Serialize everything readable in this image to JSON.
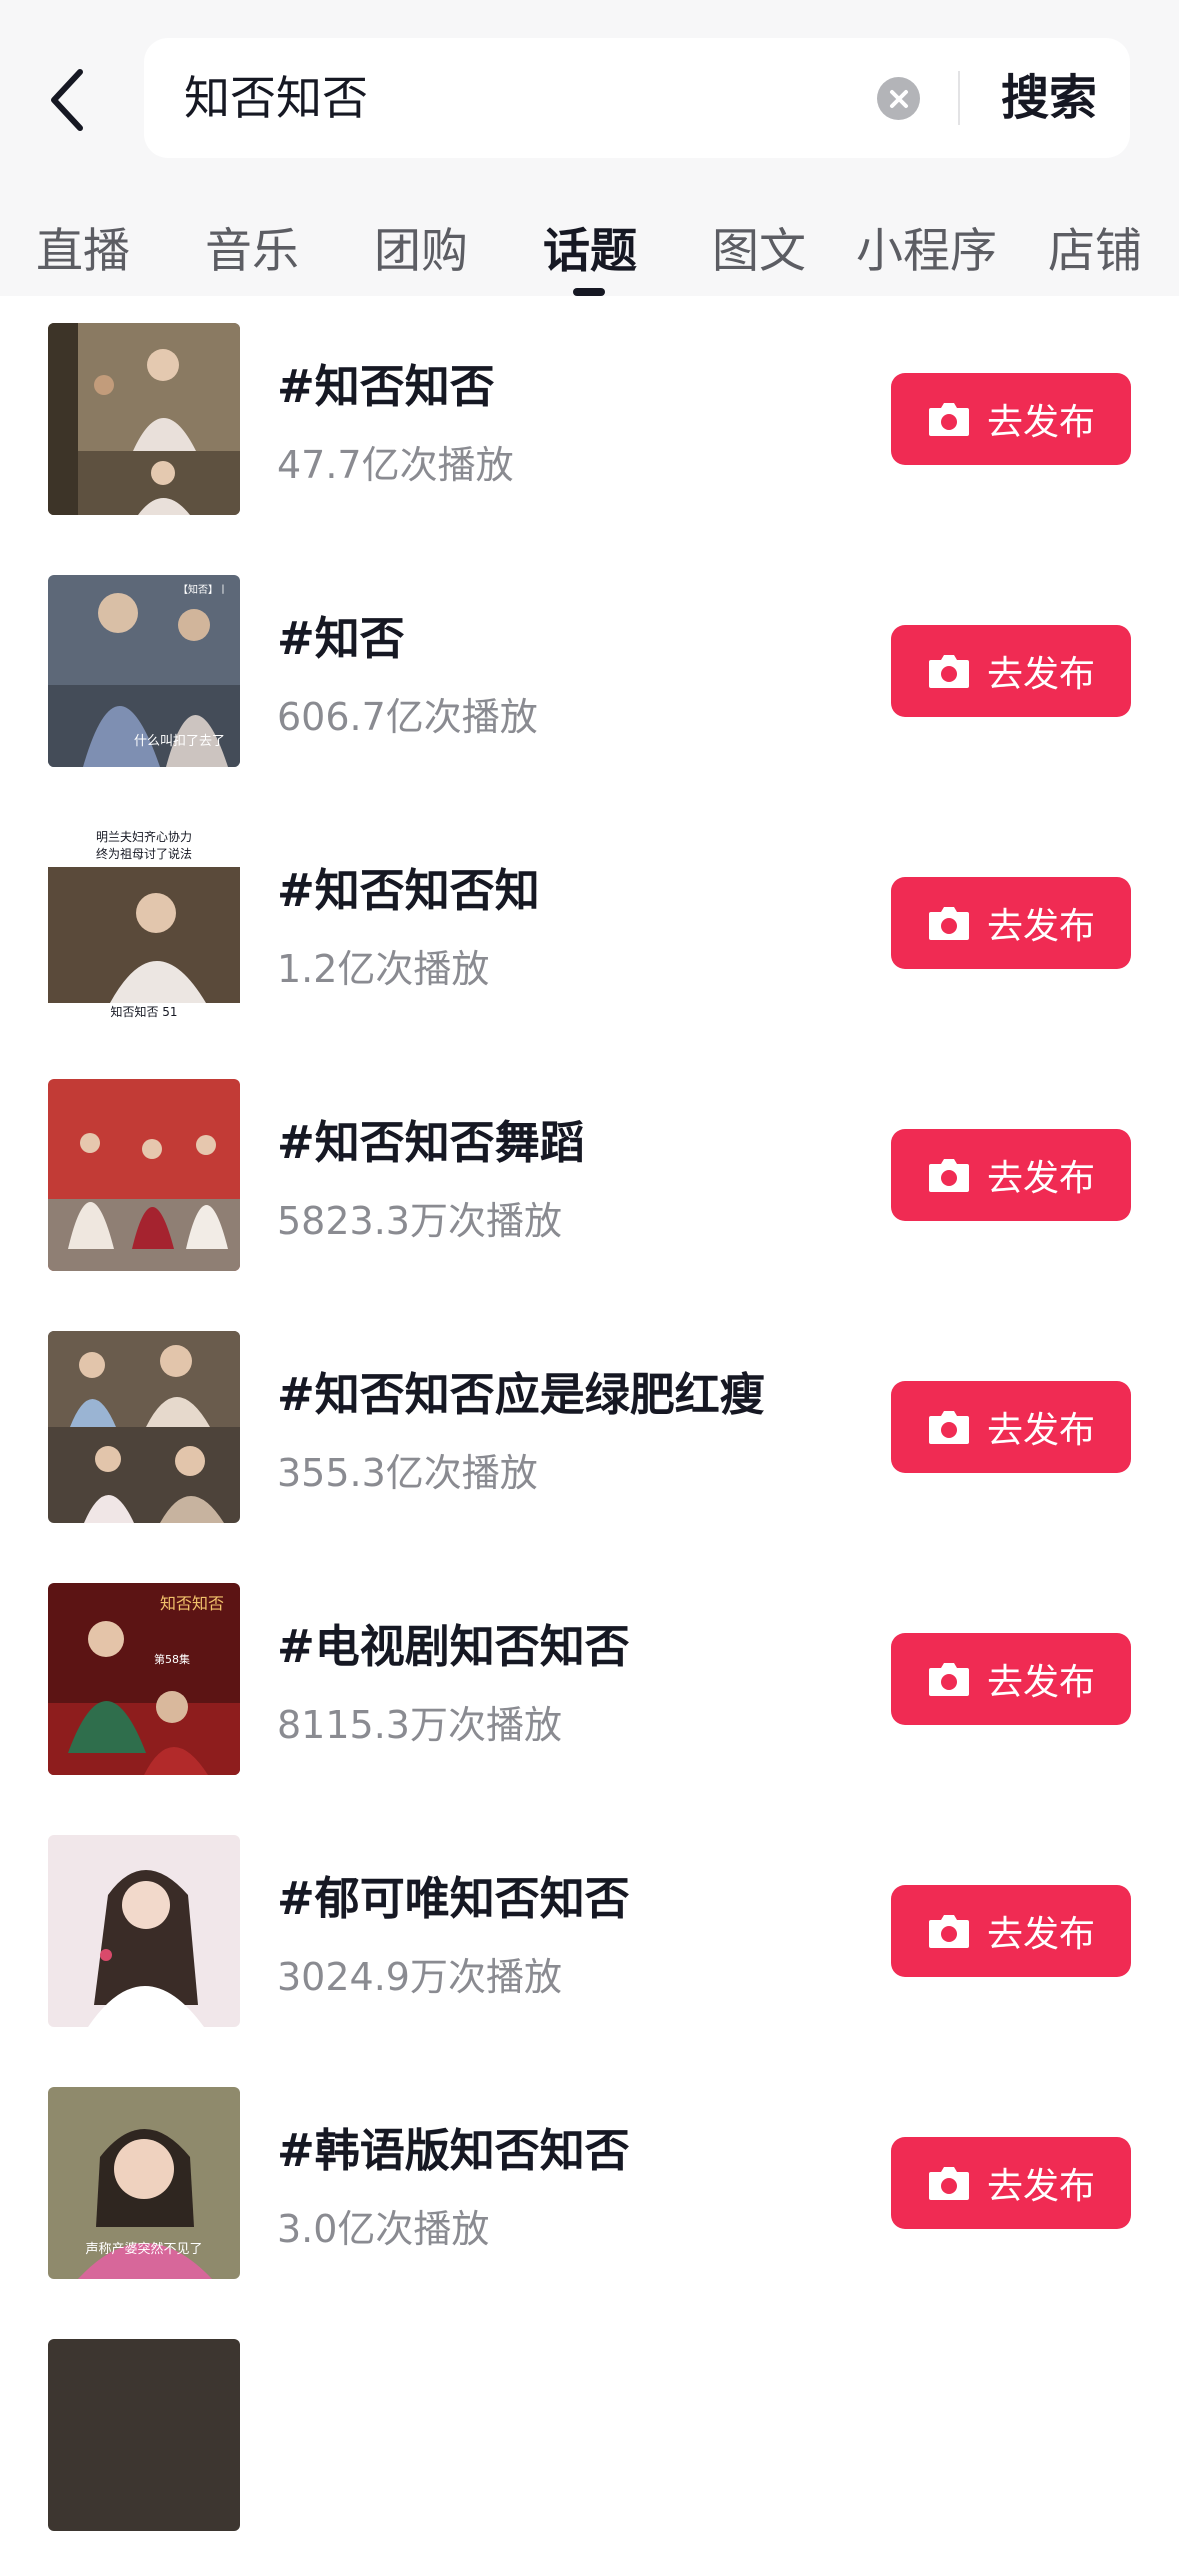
{
  "header": {
    "query": "知否知否",
    "search_label": "搜索"
  },
  "tabs": [
    {
      "label": "直播"
    },
    {
      "label": "音乐"
    },
    {
      "label": "团购"
    },
    {
      "label": "话题"
    },
    {
      "label": "图文"
    },
    {
      "label": "小程序"
    },
    {
      "label": "店铺"
    }
  ],
  "active_tab": "话题",
  "publish_label": "去发布",
  "colors": {
    "accent": "#f02b53",
    "secondary_text": "#8a8b91",
    "header_bg": "#f7f7f8"
  },
  "topics": [
    {
      "title": "#知否知否",
      "plays": "47.7亿次播放",
      "thumb_text": []
    },
    {
      "title": "#知否",
      "plays": "606.7亿次播放",
      "thumb_text": [
        "【知否】丨",
        "什么叫扣了去了"
      ]
    },
    {
      "title": "#知否知否知",
      "plays": "1.2亿次播放",
      "thumb_text": [
        "明兰夫妇齐心协力",
        "终为祖母讨了说法",
        "知否知否 51"
      ]
    },
    {
      "title": "#知否知否舞蹈",
      "plays": "5823.3万次播放",
      "thumb_text": []
    },
    {
      "title": "#知否知否应是绿肥红瘦",
      "plays": "355.3亿次播放",
      "thumb_text": []
    },
    {
      "title": "#电视剧知否知否",
      "plays": "8115.3万次播放",
      "thumb_text": [
        "第58集"
      ]
    },
    {
      "title": "#郁可唯知否知否",
      "plays": "3024.9万次播放",
      "thumb_text": []
    },
    {
      "title": "#韩语版知否知否",
      "plays": "3.0亿次播放",
      "thumb_text": [
        "声称产婆突然不见了"
      ]
    }
  ]
}
